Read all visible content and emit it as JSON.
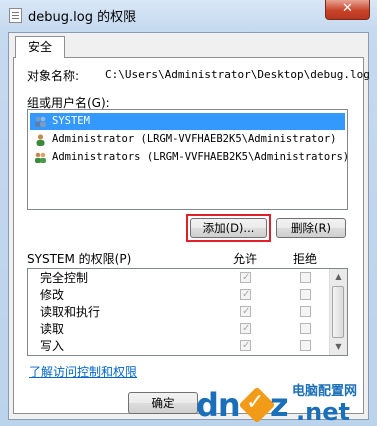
{
  "window": {
    "title": "debug.log 的权限",
    "close_glyph": "✕"
  },
  "tab": {
    "label": "安全"
  },
  "object": {
    "label": "对象名称:",
    "value": "C:\\Users\\Administrator\\Desktop\\debug.log"
  },
  "groups": {
    "label": "组或用户名(G):",
    "items": [
      {
        "text": "SYSTEM",
        "selected": true,
        "icon": "users-icon"
      },
      {
        "text": "Administrator (LRGM-VVFHAEB2K5\\Administrator)",
        "selected": false,
        "icon": "user-icon"
      },
      {
        "text": "Administrators (LRGM-VVFHAEB2K5\\Administrators)",
        "selected": false,
        "icon": "users-icon"
      }
    ]
  },
  "buttons": {
    "add": "添加(D)...",
    "remove": "删除(R)",
    "ok": "确定"
  },
  "permissions": {
    "label": "SYSTEM 的权限(P)",
    "allow_header": "允许",
    "deny_header": "拒绝",
    "rows": [
      {
        "name": "完全控制",
        "allow": true,
        "deny": false
      },
      {
        "name": "修改",
        "allow": true,
        "deny": false
      },
      {
        "name": "读取和执行",
        "allow": true,
        "deny": false
      },
      {
        "name": "读取",
        "allow": true,
        "deny": false
      },
      {
        "name": "写入",
        "allow": true,
        "deny": false
      }
    ]
  },
  "link": {
    "text": "了解访问控制和权限"
  },
  "watermark": {
    "site": "电脑配置网",
    "brand_main": "dn",
    "brand_z": "z",
    "brand_net": ".net"
  },
  "colors": {
    "selection": "#3399ff",
    "highlight_box": "#e0212a",
    "link": "#0066cc",
    "watermark_blue": "#1a6fb8",
    "watermark_orange": "#f29b19"
  }
}
